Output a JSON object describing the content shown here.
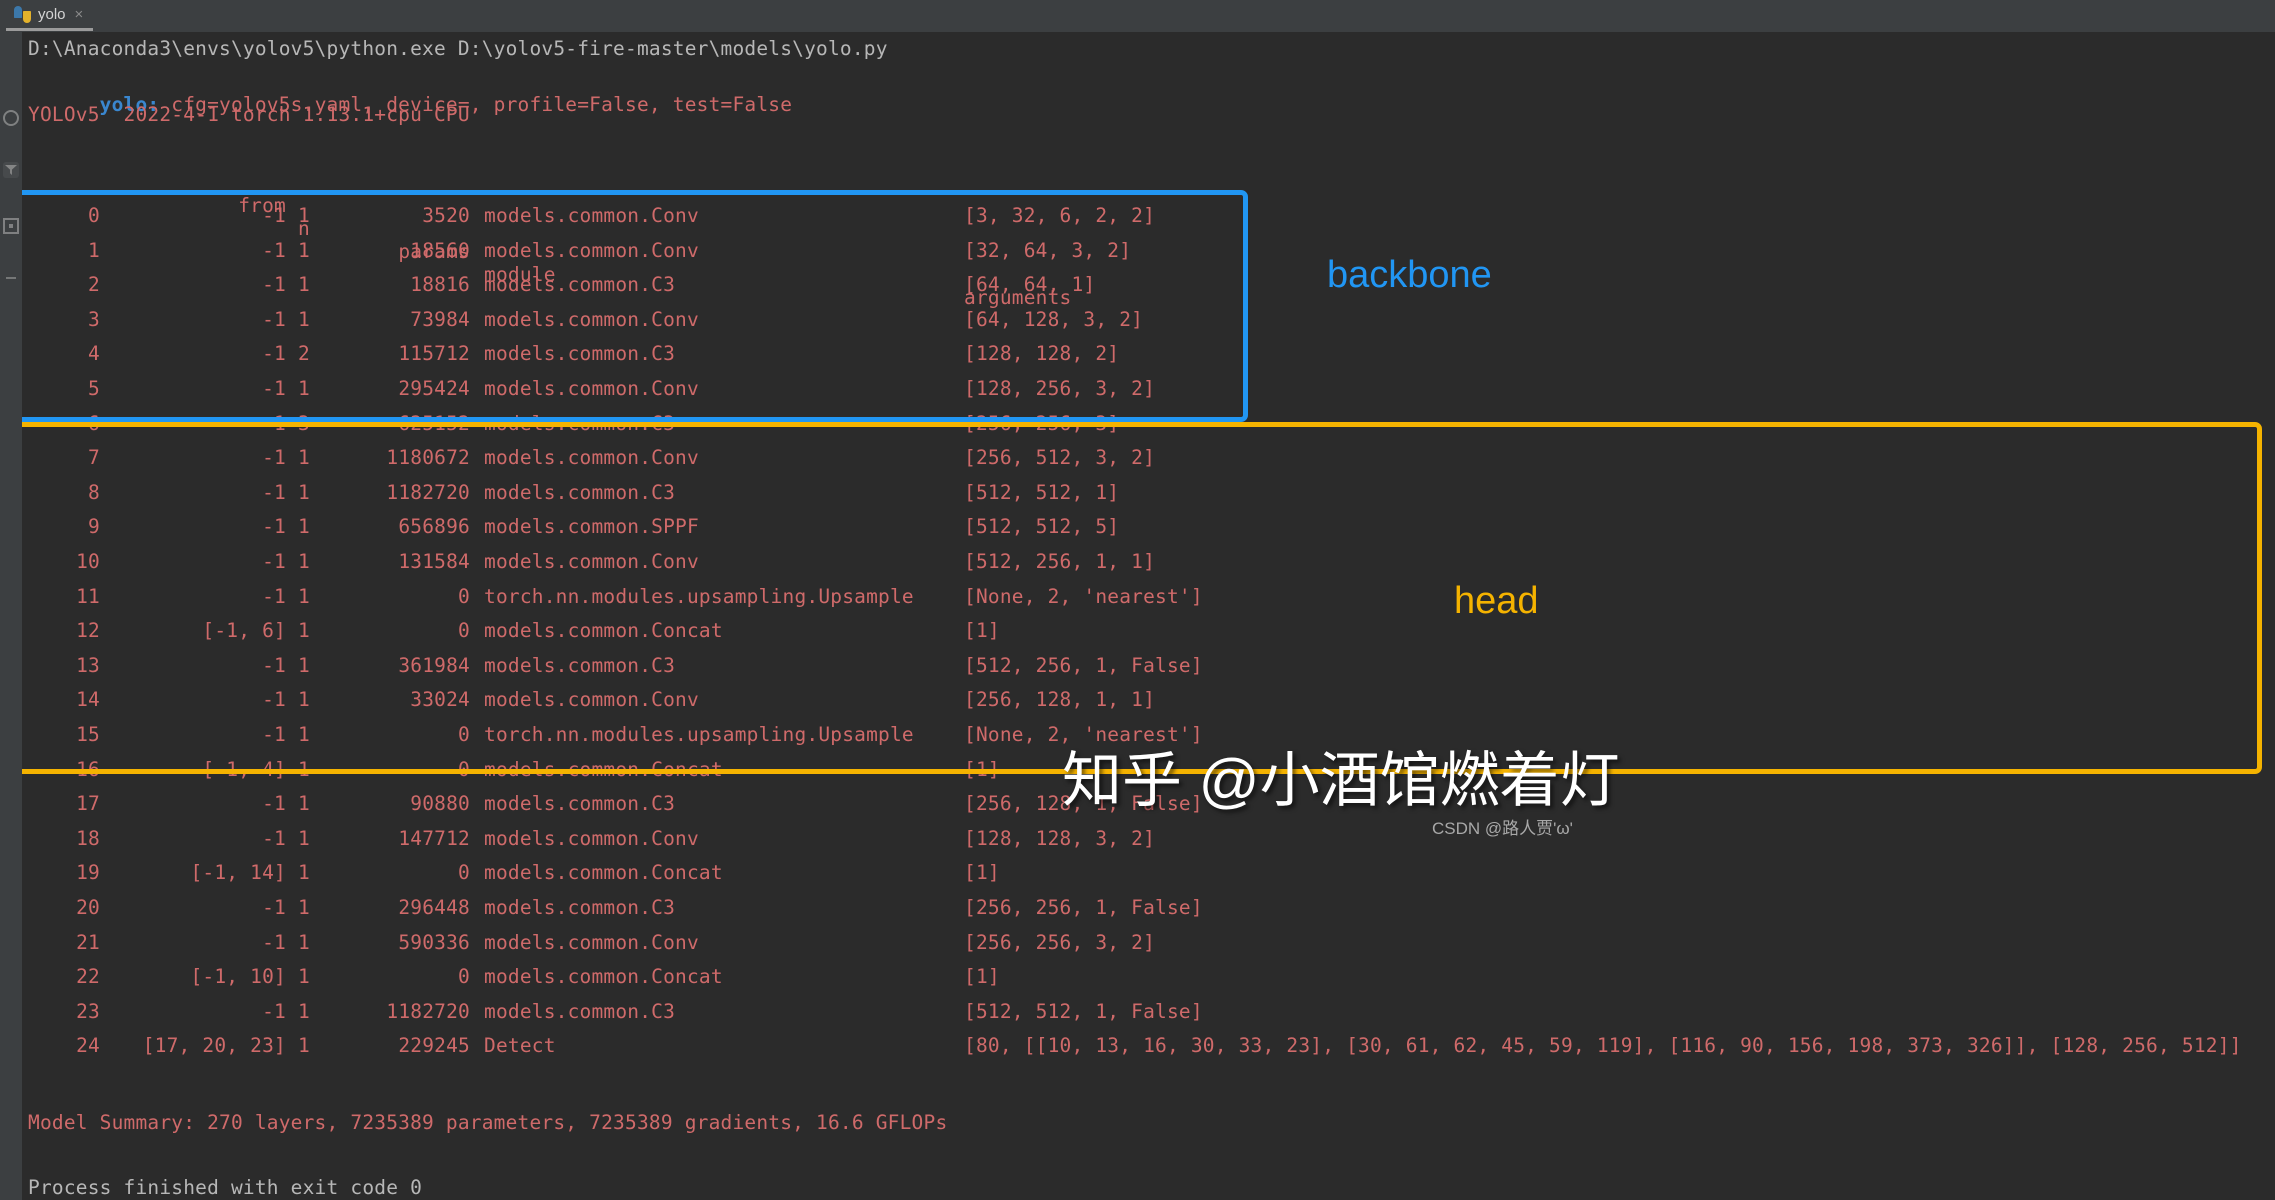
{
  "window": {
    "tab": {
      "icon": "python-file-icon",
      "label": "yolo",
      "close": "×"
    }
  },
  "gutter": {
    "icons": [
      "rerun-icon",
      "filter-icon",
      "print-icon",
      "wrap-text-icon"
    ]
  },
  "console": {
    "command_line": "D:\\Anaconda3\\envs\\yolov5\\python.exe D:\\yolov5-fire-master\\models\\yolo.py",
    "args_line": {
      "prefix": "yolo:",
      "rest": " cfg=yolov5s.yaml, device=, profile=False, test=False"
    },
    "version_line": "YOLOv5  2022-4-1 torch 1.13.1+cpu CPU",
    "table_header": {
      "index": "",
      "from": "from",
      "n": "n",
      "params": "params",
      "module": "module",
      "arguments": "arguments"
    },
    "rows": [
      {
        "idx": "0",
        "from": "-1",
        "n": "1",
        "params": "3520",
        "module": "models.common.Conv",
        "args": "[3, 32, 6, 2, 2]",
        "section": "backbone"
      },
      {
        "idx": "1",
        "from": "-1",
        "n": "1",
        "params": "18560",
        "module": "models.common.Conv",
        "args": "[32, 64, 3, 2]",
        "section": "backbone"
      },
      {
        "idx": "2",
        "from": "-1",
        "n": "1",
        "params": "18816",
        "module": "models.common.C3",
        "args": "[64, 64, 1]",
        "section": "backbone"
      },
      {
        "idx": "3",
        "from": "-1",
        "n": "1",
        "params": "73984",
        "module": "models.common.Conv",
        "args": "[64, 128, 3, 2]",
        "section": "backbone"
      },
      {
        "idx": "4",
        "from": "-1",
        "n": "2",
        "params": "115712",
        "module": "models.common.C3",
        "args": "[128, 128, 2]",
        "section": "backbone"
      },
      {
        "idx": "5",
        "from": "-1",
        "n": "1",
        "params": "295424",
        "module": "models.common.Conv",
        "args": "[128, 256, 3, 2]",
        "section": "backbone"
      },
      {
        "idx": "6",
        "from": "-1",
        "n": "3",
        "params": "625152",
        "module": "models.common.C3",
        "args": "[256, 256, 3]",
        "section": "backbone"
      },
      {
        "idx": "7",
        "from": "-1",
        "n": "1",
        "params": "1180672",
        "module": "models.common.Conv",
        "args": "[256, 512, 3, 2]",
        "section": "backbone"
      },
      {
        "idx": "8",
        "from": "-1",
        "n": "1",
        "params": "1182720",
        "module": "models.common.C3",
        "args": "[512, 512, 1]",
        "section": "backbone"
      },
      {
        "idx": "9",
        "from": "-1",
        "n": "1",
        "params": "656896",
        "module": "models.common.SPPF",
        "args": "[512, 512, 5]",
        "section": "backbone"
      },
      {
        "idx": "10",
        "from": "-1",
        "n": "1",
        "params": "131584",
        "module": "models.common.Conv",
        "args": "[512, 256, 1, 1]",
        "section": "head"
      },
      {
        "idx": "11",
        "from": "-1",
        "n": "1",
        "params": "0",
        "module": "torch.nn.modules.upsampling.Upsample",
        "args": "[None, 2, 'nearest']",
        "section": "head"
      },
      {
        "idx": "12",
        "from": "[-1, 6]",
        "n": "1",
        "params": "0",
        "module": "models.common.Concat",
        "args": "[1]",
        "section": "head"
      },
      {
        "idx": "13",
        "from": "-1",
        "n": "1",
        "params": "361984",
        "module": "models.common.C3",
        "args": "[512, 256, 1, False]",
        "section": "head"
      },
      {
        "idx": "14",
        "from": "-1",
        "n": "1",
        "params": "33024",
        "module": "models.common.Conv",
        "args": "[256, 128, 1, 1]",
        "section": "head"
      },
      {
        "idx": "15",
        "from": "-1",
        "n": "1",
        "params": "0",
        "module": "torch.nn.modules.upsampling.Upsample",
        "args": "[None, 2, 'nearest']",
        "section": "head"
      },
      {
        "idx": "16",
        "from": "[-1, 4]",
        "n": "1",
        "params": "0",
        "module": "models.common.Concat",
        "args": "[1]",
        "section": "head"
      },
      {
        "idx": "17",
        "from": "-1",
        "n": "1",
        "params": "90880",
        "module": "models.common.C3",
        "args": "[256, 128, 1, False]",
        "section": "head"
      },
      {
        "idx": "18",
        "from": "-1",
        "n": "1",
        "params": "147712",
        "module": "models.common.Conv",
        "args": "[128, 128, 3, 2]",
        "section": "head"
      },
      {
        "idx": "19",
        "from": "[-1, 14]",
        "n": "1",
        "params": "0",
        "module": "models.common.Concat",
        "args": "[1]",
        "section": "head"
      },
      {
        "idx": "20",
        "from": "-1",
        "n": "1",
        "params": "296448",
        "module": "models.common.C3",
        "args": "[256, 256, 1, False]",
        "section": "head"
      },
      {
        "idx": "21",
        "from": "-1",
        "n": "1",
        "params": "590336",
        "module": "models.common.Conv",
        "args": "[256, 256, 3, 2]",
        "section": "head"
      },
      {
        "idx": "22",
        "from": "[-1, 10]",
        "n": "1",
        "params": "0",
        "module": "models.common.Concat",
        "args": "[1]",
        "section": "head"
      },
      {
        "idx": "23",
        "from": "-1",
        "n": "1",
        "params": "1182720",
        "module": "models.common.C3",
        "args": "[512, 512, 1, False]",
        "section": "head"
      },
      {
        "idx": "24",
        "from": "[17, 20, 23]",
        "n": "1",
        "params": "229245",
        "module": "Detect",
        "args": "[80, [[10, 13, 16, 30, 33, 23], [30, 61, 62, 45, 59, 119], [116, 90, 156, 198, 373, 326]], [128, 256, 512]]",
        "section": "head"
      }
    ],
    "summary_line": "Model Summary: 270 layers, 7235389 parameters, 7235389 gradients, 16.6 GFLOPs",
    "exit_line": "Process finished with exit code 0"
  },
  "annotations": {
    "backbone": {
      "label": "backbone",
      "color": "#2196f3"
    },
    "head": {
      "label": "head",
      "color": "#f5b300"
    }
  },
  "watermarks": {
    "main": "知乎 @小酒馆燃着灯",
    "sub": "CSDN @路人贾'ω'"
  },
  "colors": {
    "background": "#2b2b2b",
    "chrome": "#3c3f41",
    "console_text": "#cf6a6a",
    "command_text": "#b7b7b7",
    "keyword": "#3a87cf",
    "backbone_box": "#2196f3",
    "head_box": "#f5b300"
  }
}
